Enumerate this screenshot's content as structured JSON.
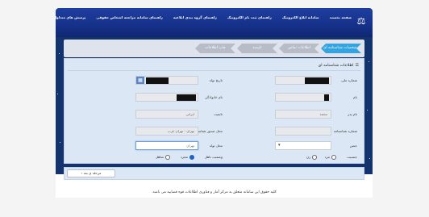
{
  "header": {
    "nav": [
      "صفحه نخست",
      "سامانه ابلاغ الکترونیک",
      "راهنمای ثبت نام الکترونیک",
      "راهنمای گروه بندی ابلاغیه",
      "راهنمای سامانه مراجعه اشخاص حقوقی",
      "پرسش های متداول"
    ]
  },
  "steps": [
    "مشخصات شناسنامه ای",
    "اطلاعات تماس",
    "تاییدیه",
    "چاپ اطلاعات"
  ],
  "card": {
    "title": "اطلاعات شناسنامه ای",
    "labels": {
      "national_code": "شماره ملی",
      "birth_date": "تاریخ تولد",
      "first_name": "نام",
      "last_name": "نام خانوادگی",
      "father_name": "نام پدر",
      "nationality": "تابعیت",
      "id_number": "شماره شناسنامه",
      "issue_place": "محل صدور شناسنامه",
      "gender": "جنس",
      "birth_place": "محل تولد",
      "sex_label": "جنسیت",
      "marital": "وضعیت تاهل"
    },
    "values": {
      "father_name": "محمد",
      "nationality": "ایرانی",
      "issue_place": "تهران - تهران غرب",
      "gender_placeholder": "",
      "birth_place": "تهران"
    },
    "sex_options": [
      "مرد",
      "زن"
    ],
    "marital_options": [
      "مجرد",
      "متاهل"
    ]
  },
  "actions": {
    "back": "مرحله ی بعد"
  },
  "footer": "کلیه حقوق این سامانه متعلق به مرکز آمار و فناوری اطلاعات قوه قضاییه می باشد."
}
